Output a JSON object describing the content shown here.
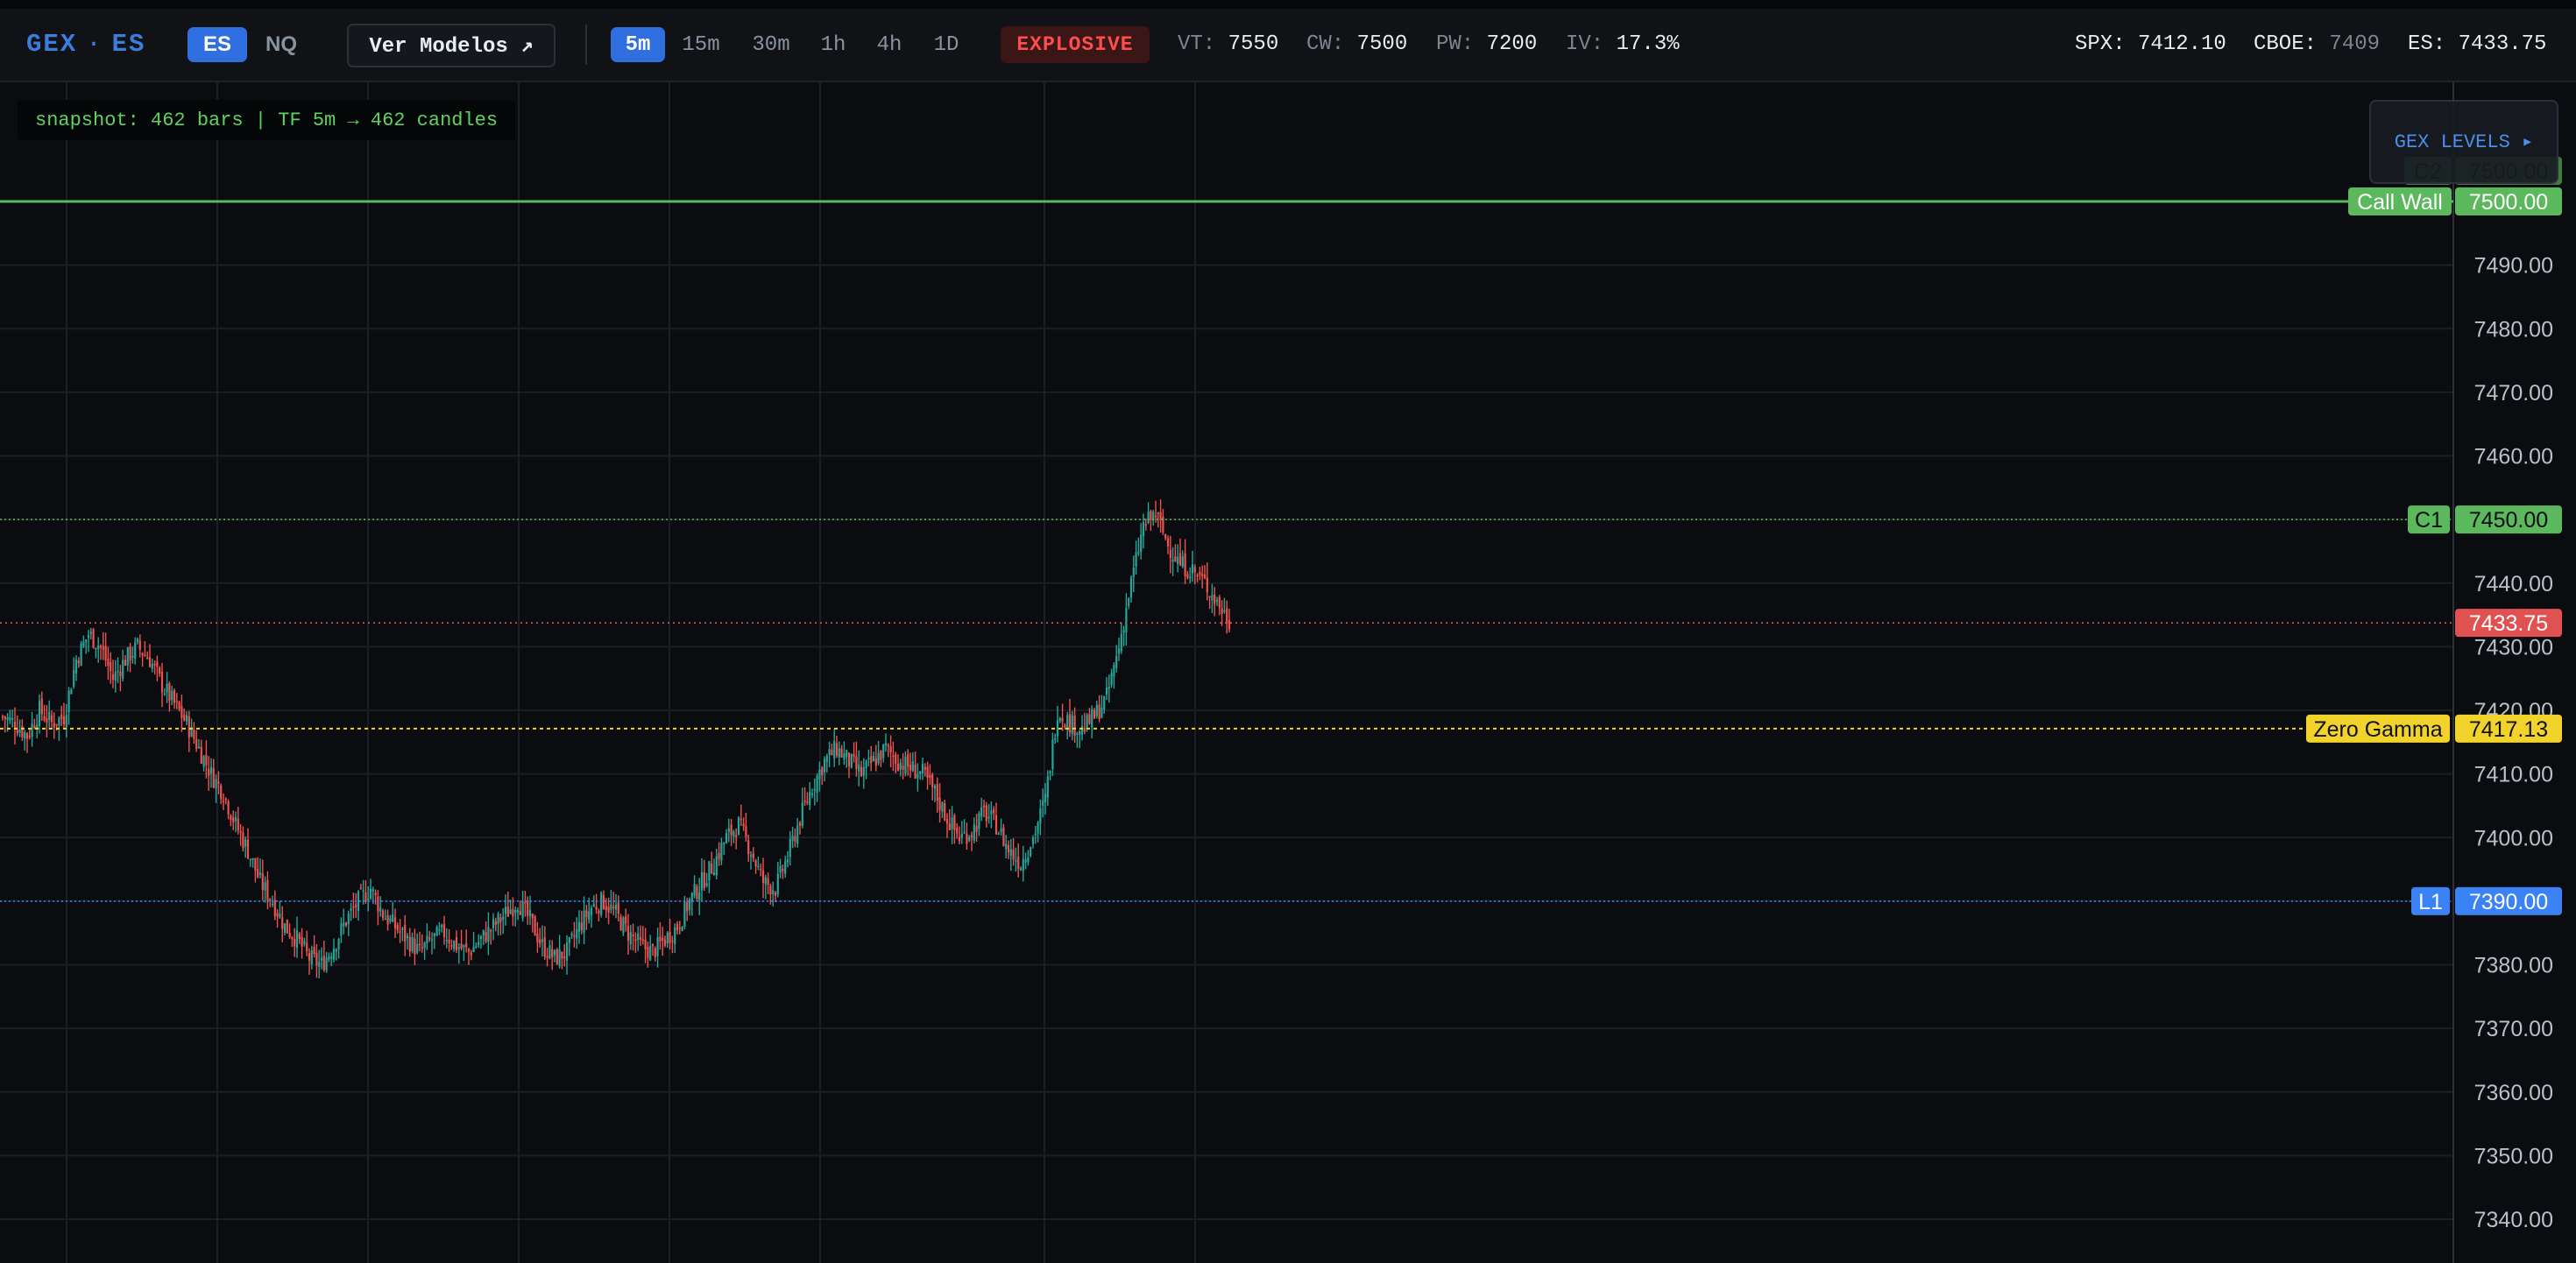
{
  "topbar": {
    "brand": "GEX",
    "brand_dot": "·",
    "brand_symbol": "ES",
    "symbols": [
      "ES",
      "NQ"
    ],
    "modelos_button": "Ver Modelos ↗",
    "timeframes": [
      "5m",
      "15m",
      "30m",
      "1h",
      "4h",
      "1D"
    ],
    "active_timeframe": "5m",
    "regime": "EXPLOSIVE",
    "stats": [
      {
        "key": "VT:",
        "value": "7550"
      },
      {
        "key": "CW:",
        "value": "7500"
      },
      {
        "key": "PW:",
        "value": "7200"
      },
      {
        "key": "IV:",
        "value": "17.3%"
      }
    ],
    "quotes": {
      "spx_key": "SPX:",
      "spx_value": "7412.10",
      "cboe_key": "CBOE:",
      "cboe_value": "7409",
      "es_key": "ES:",
      "es_value": "7433.75"
    }
  },
  "snapshot": "snapshot: 462 bars | TF 5m → 462 candles",
  "gex_panel": "GEX LEVELS ▸",
  "colors": {
    "up": "#26a69a",
    "down": "#ef5350",
    "call_wall": "#5cb85c",
    "zero_gamma": "#f2d32c",
    "l1": "#3b82f6",
    "current": "#e05252"
  },
  "chart_data": {
    "type": "candlestick",
    "ylim": [
      7335,
      7515
    ],
    "yticks": [
      "7340.00",
      "7350.00",
      "7360.00",
      "7370.00",
      "7380.00",
      "7390.00",
      "7400.00",
      "7410.00",
      "7420.00",
      "7430.00",
      "7440.00",
      "7450.00",
      "7460.00",
      "7470.00",
      "7480.00",
      "7490.00",
      "7500.00"
    ],
    "levels": [
      {
        "name": "C2",
        "value": "7500.00"
      },
      {
        "name": "Call Wall",
        "value": "7500.00"
      },
      {
        "name": "C1",
        "value": "7450.00"
      },
      {
        "name": "",
        "value": "7433.75"
      },
      {
        "name": "Zero Gamma",
        "value": "7417.13"
      },
      {
        "name": "L1",
        "value": "7390.00"
      }
    ],
    "close_path": [
      7419,
      7418,
      7416,
      7420,
      7418,
      7419,
      7428,
      7432,
      7430,
      7425,
      7428,
      7430,
      7428,
      7424,
      7421,
      7418,
      7414,
      7410,
      7407,
      7402,
      7398,
      7393,
      7390,
      7386,
      7384,
      7381,
      7380,
      7383,
      7387,
      7390,
      7392,
      7388,
      7386,
      7384,
      7382,
      7384,
      7385,
      7383,
      7382,
      7384,
      7386,
      7388,
      7390,
      7387,
      7383,
      7381,
      7382,
      7386,
      7389,
      7390,
      7388,
      7385,
      7383,
      7382,
      7384,
      7386,
      7390,
      7393,
      7396,
      7400,
      7402,
      7398,
      7393,
      7392,
      7397,
      7403,
      7408,
      7412,
      7414,
      7412,
      7410,
      7412,
      7414,
      7412,
      7411,
      7410,
      7407,
      7403,
      7400,
      7401,
      7404,
      7402,
      7398,
      7396,
      7400,
      7406,
      7420,
      7418,
      7417,
      7419,
      7422,
      7430,
      7440,
      7449,
      7451,
      7446,
      7443,
      7442,
      7440,
      7437,
      7434
    ]
  }
}
